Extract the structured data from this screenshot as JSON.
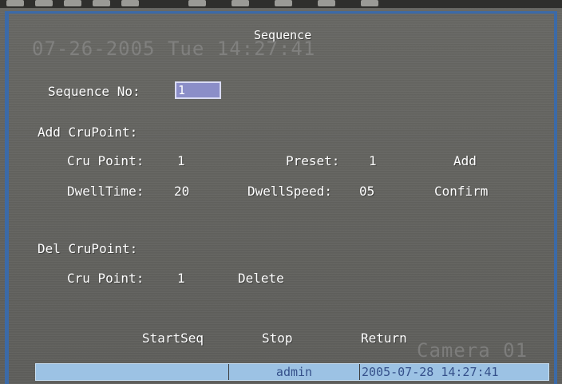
{
  "osd": {
    "datetime_overlay": "07-26-2005 Tue 14:27:41",
    "camera_overlay": "Camera 01"
  },
  "menu": {
    "title": "Sequence",
    "sequence_no_label": "Sequence No:",
    "sequence_no_value": "1",
    "add_section": {
      "heading": "Add CruPoint:",
      "cru_point_label": "Cru Point:",
      "cru_point_value": "1",
      "preset_label": "Preset:",
      "preset_value": "1",
      "add_button": "Add",
      "dwell_time_label": "DwellTime:",
      "dwell_time_value": "20",
      "dwell_speed_label": "DwellSpeed:",
      "dwell_speed_value": "05",
      "confirm_button": "Confirm"
    },
    "del_section": {
      "heading": "Del CruPoint:",
      "cru_point_label": "Cru Point:",
      "cru_point_value": "1",
      "delete_button": "Delete"
    },
    "actions": {
      "start_seq": "StartSeq",
      "stop": "Stop",
      "return": "Return"
    }
  },
  "status_bar": {
    "user": "admin",
    "datetime": "2005-07-28 14:27:41"
  },
  "colors": {
    "background": "#62625e",
    "frame_blue": "#3b6aa8",
    "input_fill": "#8b8ec8",
    "status_fill": "#9cc2e4",
    "status_text": "#35508a"
  }
}
